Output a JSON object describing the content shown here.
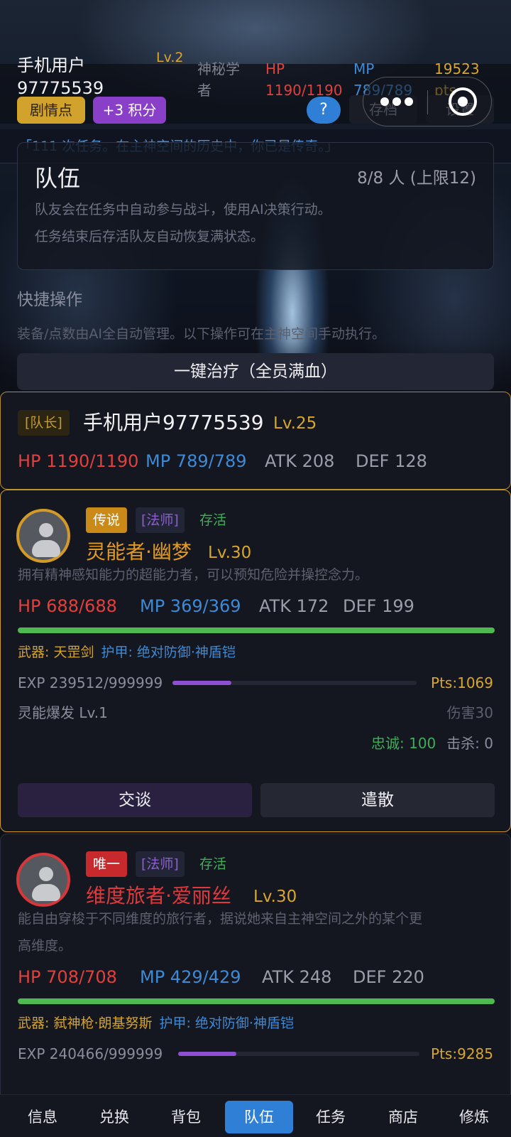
{
  "header": {
    "username": "手机用户97775539",
    "level": "Lv.2",
    "title": "神秘学者",
    "hp": "HP 1190/1190",
    "mp": "MP 789/789",
    "points": "19523 pts",
    "story_chip": "剧情点",
    "score_chip": "+3 积分",
    "help": "?",
    "save": "存档",
    "settings": "设置"
  },
  "quote": "「111 次任务。在主神空间的历史中，你已是传奇。」",
  "team": {
    "title": "队伍",
    "count": "8/8 人 (上限12)",
    "desc1": "队友会在任务中自动参与战斗，使用AI决策行动。",
    "desc2": "任务结束后存活队友自动恢复满状态。"
  },
  "quick": {
    "title": "快捷操作",
    "desc": "装备/点数由AI全自动管理。以下操作可在主神空间手动执行。",
    "heal_button": "一键治疗（全员满血）"
  },
  "leader": {
    "tag": "[队长]",
    "name": "手机用户97775539",
    "level": "Lv.25",
    "hp": "HP 1190/1190",
    "mp": "MP 789/789",
    "atk": "ATK 208",
    "def": "DEF 128"
  },
  "members": [
    {
      "rarity": "传说",
      "class": "[法师]",
      "status": "存活",
      "name": "灵能者·幽梦",
      "level": "Lv.30",
      "desc_line1": "拥有精神感知能力的超能力者，可以预知危险并操控念力。",
      "hp": "HP 688/688",
      "mp": "MP 369/369",
      "atk": "ATK 172",
      "def": "DEF 199",
      "hp_fraction": 1.0,
      "weapon": "武器: 天罡剑",
      "armor": "护甲: 绝对防御·神盾铠",
      "exp": "EXP 239512/999999",
      "exp_fraction": 0.24,
      "pts": "Pts:1069",
      "skill": "灵能爆发 Lv.1",
      "damage": "伤害30",
      "loyalty": "忠诚: 100",
      "kills": "击杀: 0",
      "talk": "交谈",
      "dismiss": "遣散",
      "name_color": "#e39a22"
    },
    {
      "rarity": "唯一",
      "class": "[法师]",
      "status": "存活",
      "name": "维度旅者·爱丽丝",
      "level": "Lv.30",
      "desc_line1": "能自由穿梭于不同维度的旅行者，据说她来自主神空间之外的某个更",
      "desc_line2": "高维度。",
      "hp": "HP 708/708",
      "mp": "MP 429/429",
      "atk": "ATK 248",
      "def": "DEF 220",
      "hp_fraction": 1.0,
      "weapon": "武器: 弑神枪·朗基努斯",
      "armor": "护甲: 绝对防御·神盾铠",
      "exp": "EXP 240466/999999",
      "exp_fraction": 0.24,
      "pts": "Pts:9285",
      "name_color": "#e0393c"
    }
  ],
  "nav": {
    "items": [
      "信息",
      "兑换",
      "背包",
      "队伍",
      "任务",
      "商店",
      "修炼"
    ],
    "active": "队伍"
  },
  "icons": {
    "menu": "more-dots-icon",
    "close": "target-circle-icon",
    "avatar": "user-avatar-icon"
  },
  "colors": {
    "gold": "#d8a62b",
    "hp_red": "#e0413c",
    "mp_blue": "#3d8ad6",
    "accent_blue": "#2f7fd6",
    "alive_green": "#3fae56"
  }
}
